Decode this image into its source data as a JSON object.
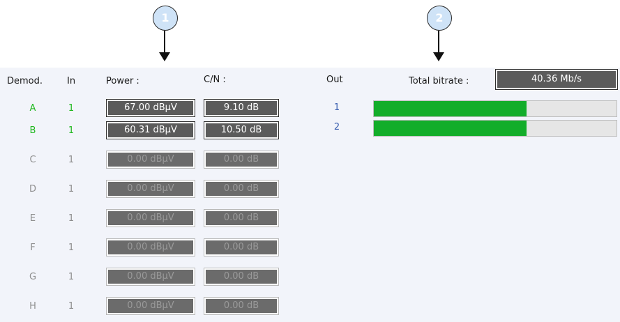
{
  "callouts": [
    "1",
    "2"
  ],
  "headers": {
    "demod": "Demod.",
    "in": "In",
    "power": "Power :",
    "cn": "C/N :",
    "out": "Out",
    "total_bitrate": "Total bitrate :"
  },
  "total_bitrate_value": "40.36 Mb/s",
  "rows": [
    {
      "demod": "A",
      "in": "1",
      "power": "67.00 dBµV",
      "cn": "9.10 dB",
      "active": true
    },
    {
      "demod": "B",
      "in": "1",
      "power": "60.31 dBµV",
      "cn": "10.50 dB",
      "active": true
    },
    {
      "demod": "C",
      "in": "1",
      "power": "0.00 dBµV",
      "cn": "0.00 dB",
      "active": false
    },
    {
      "demod": "D",
      "in": "1",
      "power": "0.00 dBµV",
      "cn": "0.00 dB",
      "active": false
    },
    {
      "demod": "E",
      "in": "1",
      "power": "0.00 dBµV",
      "cn": "0.00 dB",
      "active": false
    },
    {
      "demod": "F",
      "in": "1",
      "power": "0.00 dBµV",
      "cn": "0.00 dB",
      "active": false
    },
    {
      "demod": "G",
      "in": "1",
      "power": "0.00 dBµV",
      "cn": "0.00 dB",
      "active": false
    },
    {
      "demod": "H",
      "in": "1",
      "power": "0.00 dBµV",
      "cn": "0.00 dB",
      "active": false
    }
  ],
  "outputs": [
    {
      "label": "1",
      "fill_fraction": 0.63
    },
    {
      "label": "2",
      "fill_fraction": 0.63
    }
  ],
  "colors": {
    "active_text": "#1fb81f",
    "inactive_text": "#8e8e8e",
    "bar_fill": "#13ad2a",
    "display_bg": "#5b5b5b",
    "panel_bg": "#f2f4fa"
  }
}
